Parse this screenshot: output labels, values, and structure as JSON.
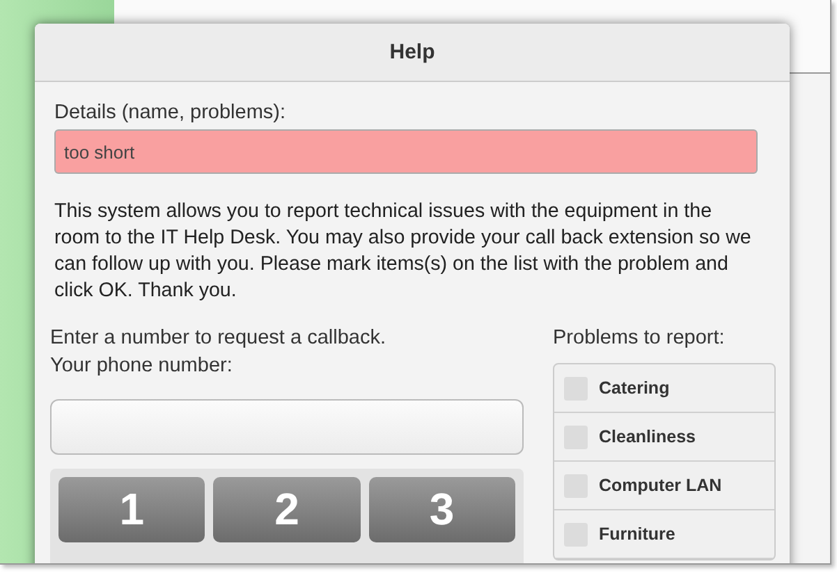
{
  "dialog": {
    "title": "Help"
  },
  "details": {
    "label": "Details (name, problems):",
    "value": "too short",
    "invalid": true
  },
  "description": "This system allows you to report technical issues with the equipment in the room to the IT Help Desk. You may also provide your call back extension so we can follow up with you. Please mark items(s) on the list with the problem and click OK. Thank you.",
  "callback": {
    "prompt": "Enter a number to request a callback.",
    "label": "Your phone number:"
  },
  "keypad": [
    "1",
    "2",
    "3"
  ],
  "problems": {
    "heading": "Problems to report:",
    "items": [
      {
        "label": "Catering",
        "checked": false
      },
      {
        "label": "Cleanliness",
        "checked": false
      },
      {
        "label": "Computer LAN",
        "checked": false
      },
      {
        "label": "Furniture",
        "checked": false
      }
    ]
  }
}
